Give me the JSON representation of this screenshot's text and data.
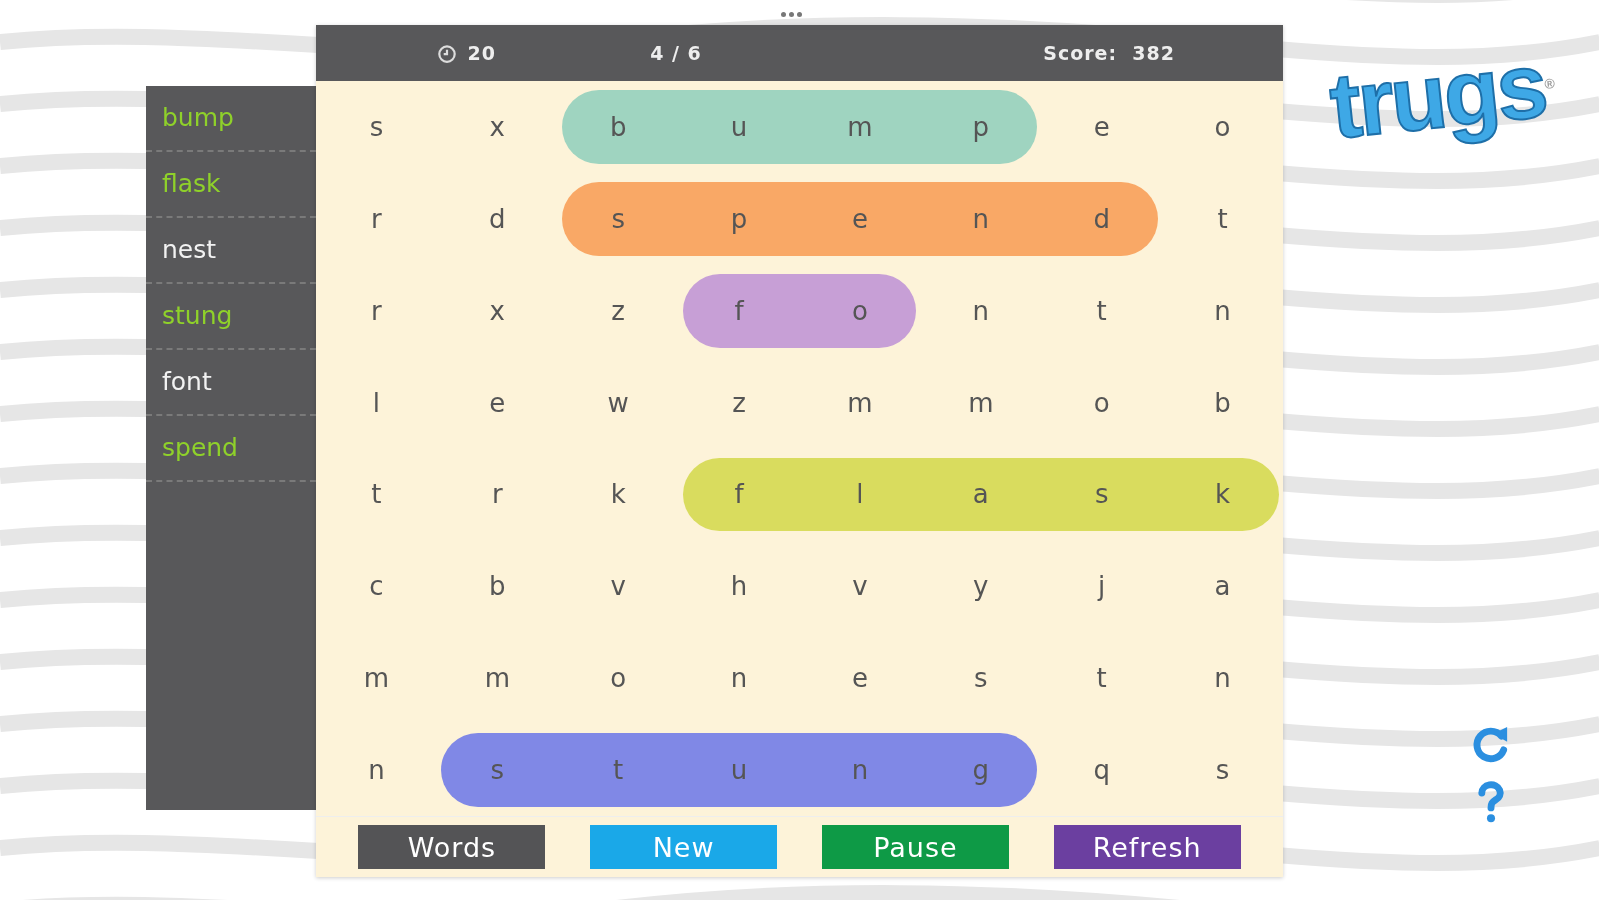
{
  "timer": "20",
  "progress": "4 / 6",
  "score": "Score:  382",
  "words": [
    {
      "label": "bump",
      "found": true
    },
    {
      "label": "flask",
      "found": true
    },
    {
      "label": "nest",
      "found": false
    },
    {
      "label": "stung",
      "found": true
    },
    {
      "label": "font",
      "found": false
    },
    {
      "label": "spend",
      "found": true
    }
  ],
  "grid": [
    [
      {
        "letter": "s"
      },
      {
        "letter": "x"
      },
      {
        "letter": "b",
        "color": "#9fd4c0"
      },
      {
        "letter": "u",
        "color": "#9fd4c0"
      },
      {
        "letter": "m",
        "color": "#9fd4c0"
      },
      {
        "letter": "p",
        "color": "#9fd4c0"
      },
      {
        "letter": "e"
      },
      {
        "letter": "o"
      }
    ],
    [
      {
        "letter": "r"
      },
      {
        "letter": "d"
      },
      {
        "letter": "s",
        "color": "#f9a866"
      },
      {
        "letter": "p",
        "color": "#f9a866"
      },
      {
        "letter": "e",
        "color": "#f9a866"
      },
      {
        "letter": "n",
        "color": "#f9a866"
      },
      {
        "letter": "d",
        "color": "#f9a866"
      },
      {
        "letter": "t"
      }
    ],
    [
      {
        "letter": "r"
      },
      {
        "letter": "x"
      },
      {
        "letter": "z"
      },
      {
        "letter": "f",
        "color": "#c79fd6"
      },
      {
        "letter": "o",
        "color": "#c79fd6"
      },
      {
        "letter": "n"
      },
      {
        "letter": "t"
      },
      {
        "letter": "n"
      }
    ],
    [
      {
        "letter": "l"
      },
      {
        "letter": "e"
      },
      {
        "letter": "w"
      },
      {
        "letter": "z"
      },
      {
        "letter": "m"
      },
      {
        "letter": "m"
      },
      {
        "letter": "o"
      },
      {
        "letter": "b"
      }
    ],
    [
      {
        "letter": "t"
      },
      {
        "letter": "r"
      },
      {
        "letter": "k"
      },
      {
        "letter": "f",
        "color": "#d9dc5e"
      },
      {
        "letter": "l",
        "color": "#d9dc5e"
      },
      {
        "letter": "a",
        "color": "#d9dc5e"
      },
      {
        "letter": "s",
        "color": "#d9dc5e"
      },
      {
        "letter": "k",
        "color": "#d9dc5e"
      }
    ],
    [
      {
        "letter": "c"
      },
      {
        "letter": "b"
      },
      {
        "letter": "v"
      },
      {
        "letter": "h"
      },
      {
        "letter": "v"
      },
      {
        "letter": "y"
      },
      {
        "letter": "j"
      },
      {
        "letter": "a"
      }
    ],
    [
      {
        "letter": "m"
      },
      {
        "letter": "m"
      },
      {
        "letter": "o"
      },
      {
        "letter": "n"
      },
      {
        "letter": "e"
      },
      {
        "letter": "s"
      },
      {
        "letter": "t"
      },
      {
        "letter": "n"
      }
    ],
    [
      {
        "letter": "n"
      },
      {
        "letter": "s",
        "color": "#8088e6"
      },
      {
        "letter": "t",
        "color": "#8088e6"
      },
      {
        "letter": "u",
        "color": "#8088e6"
      },
      {
        "letter": "n",
        "color": "#8088e6"
      },
      {
        "letter": "g",
        "color": "#8088e6"
      },
      {
        "letter": "q"
      },
      {
        "letter": "s"
      }
    ]
  ],
  "buttons": [
    {
      "label": "Words",
      "color": "#545456"
    },
    {
      "label": "New",
      "color": "#1aa8e8"
    },
    {
      "label": "Pause",
      "color": "#0e9a46"
    },
    {
      "label": "Refresh",
      "color": "#6b3fa0"
    }
  ],
  "logo": {
    "text": "trugs",
    "mark": "®"
  }
}
